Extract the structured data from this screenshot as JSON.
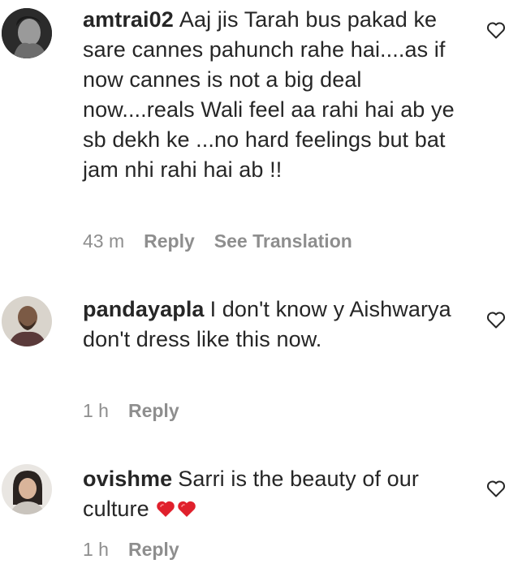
{
  "comments": [
    {
      "username": "amtrai02",
      "text": "Aaj jis Tarah bus pakad ke sare cannes pahunch rahe hai....as if now cannes is not a big deal now....reals Wali feel aa rahi hai ab ye sb dekh ke ...no hard feelings but bat jam nhi rahi hai ab !!",
      "time": "43 m",
      "reply_label": "Reply",
      "translate_label": "See Translation"
    },
    {
      "username": "pandayapla",
      "text": "I don't know y Aishwarya don't dress like this now.",
      "time": "1 h",
      "reply_label": "Reply"
    },
    {
      "username": "ovishme",
      "text": "Sarri is the beauty of our culture",
      "emoji": [
        "red-heart",
        "red-heart"
      ],
      "time": "1 h",
      "reply_label": "Reply"
    }
  ],
  "icons": {
    "like": "heart-outline-icon"
  },
  "colors": {
    "text": "#262626",
    "meta": "#8e8e8e",
    "heart_emoji": "#e0202c"
  }
}
